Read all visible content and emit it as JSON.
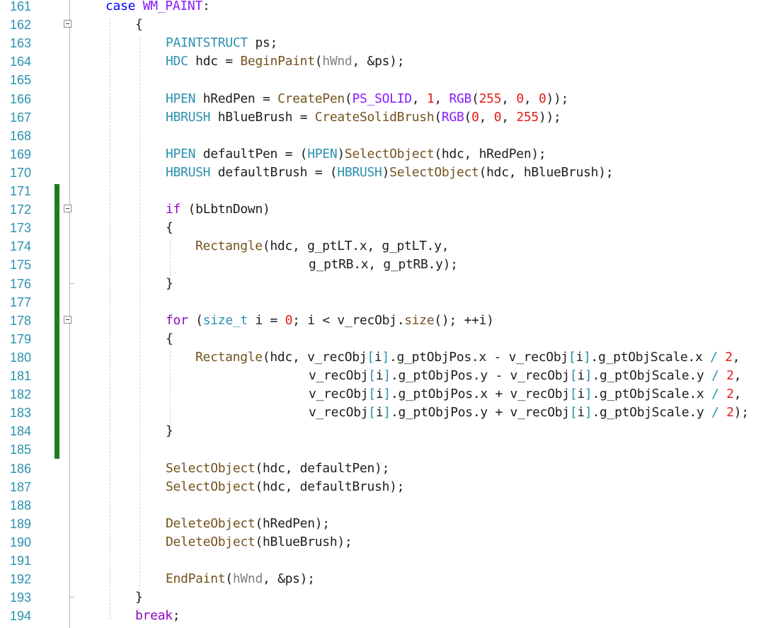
{
  "editor": {
    "line_numbers": [
      "161",
      "162",
      "163",
      "164",
      "165",
      "166",
      "167",
      "168",
      "169",
      "170",
      "171",
      "172",
      "173",
      "174",
      "175",
      "176",
      "177",
      "178",
      "179",
      "180",
      "181",
      "182",
      "183",
      "184",
      "185",
      "186",
      "187",
      "188",
      "189",
      "190",
      "191",
      "192",
      "193",
      "194"
    ],
    "colors": {
      "keyword": "#0000ff",
      "control_keyword": "#8f08c4",
      "type": "#2b91af",
      "function": "#74531f",
      "number": "#e51c1c",
      "parameter": "#808080",
      "line_number": "#2b91af",
      "change_bar": "#1f7a1f"
    },
    "lines": [
      {
        "ln": "161",
        "tokens": [
          {
            "t": "case ",
            "c": "kw"
          },
          {
            "t": "WM_PAINT",
            "c": "macro"
          },
          {
            "t": ":",
            "c": "plain"
          }
        ]
      },
      {
        "ln": "162",
        "tokens": [
          {
            "t": "{",
            "c": "plain"
          }
        ]
      },
      {
        "ln": "163",
        "tokens": [
          {
            "t": "PAINTSTRUCT",
            "c": "type"
          },
          {
            "t": " ps;",
            "c": "plain"
          }
        ]
      },
      {
        "ln": "164",
        "tokens": [
          {
            "t": "HDC",
            "c": "type"
          },
          {
            "t": " hdc = ",
            "c": "plain"
          },
          {
            "t": "BeginPaint",
            "c": "fn"
          },
          {
            "t": "(",
            "c": "plain"
          },
          {
            "t": "hWnd",
            "c": "param"
          },
          {
            "t": ", &ps);",
            "c": "plain"
          }
        ]
      },
      {
        "ln": "165",
        "tokens": []
      },
      {
        "ln": "166",
        "tokens": [
          {
            "t": "HPEN",
            "c": "type"
          },
          {
            "t": " hRedPen = ",
            "c": "plain"
          },
          {
            "t": "CreatePen",
            "c": "fn"
          },
          {
            "t": "(",
            "c": "plain"
          },
          {
            "t": "PS_SOLID",
            "c": "macro"
          },
          {
            "t": ", ",
            "c": "plain"
          },
          {
            "t": "1",
            "c": "num"
          },
          {
            "t": ", ",
            "c": "plain"
          },
          {
            "t": "RGB",
            "c": "macro"
          },
          {
            "t": "(",
            "c": "plain"
          },
          {
            "t": "255",
            "c": "num"
          },
          {
            "t": ", ",
            "c": "plain"
          },
          {
            "t": "0",
            "c": "num"
          },
          {
            "t": ", ",
            "c": "plain"
          },
          {
            "t": "0",
            "c": "num"
          },
          {
            "t": "));",
            "c": "plain"
          }
        ]
      },
      {
        "ln": "167",
        "tokens": [
          {
            "t": "HBRUSH",
            "c": "type"
          },
          {
            "t": " hBlueBrush = ",
            "c": "plain"
          },
          {
            "t": "CreateSolidBrush",
            "c": "fn"
          },
          {
            "t": "(",
            "c": "plain"
          },
          {
            "t": "RGB",
            "c": "macro"
          },
          {
            "t": "(",
            "c": "plain"
          },
          {
            "t": "0",
            "c": "num"
          },
          {
            "t": ", ",
            "c": "plain"
          },
          {
            "t": "0",
            "c": "num"
          },
          {
            "t": ", ",
            "c": "plain"
          },
          {
            "t": "255",
            "c": "num"
          },
          {
            "t": "));",
            "c": "plain"
          }
        ]
      },
      {
        "ln": "168",
        "tokens": []
      },
      {
        "ln": "169",
        "tokens": [
          {
            "t": "HPEN",
            "c": "type"
          },
          {
            "t": " defaultPen = (",
            "c": "plain"
          },
          {
            "t": "HPEN",
            "c": "type"
          },
          {
            "t": ")",
            "c": "plain"
          },
          {
            "t": "SelectObject",
            "c": "fn"
          },
          {
            "t": "(hdc, hRedPen);",
            "c": "plain"
          }
        ]
      },
      {
        "ln": "170",
        "tokens": [
          {
            "t": "HBRUSH",
            "c": "type"
          },
          {
            "t": " defaultBrush = (",
            "c": "plain"
          },
          {
            "t": "HBRUSH",
            "c": "type"
          },
          {
            "t": ")",
            "c": "plain"
          },
          {
            "t": "SelectObject",
            "c": "fn"
          },
          {
            "t": "(hdc, hBlueBrush);",
            "c": "plain"
          }
        ]
      },
      {
        "ln": "171",
        "tokens": []
      },
      {
        "ln": "172",
        "tokens": [
          {
            "t": "if",
            "c": "kw2"
          },
          {
            "t": " (bLbtnDown)",
            "c": "plain"
          }
        ]
      },
      {
        "ln": "173",
        "tokens": [
          {
            "t": "{",
            "c": "plain"
          }
        ]
      },
      {
        "ln": "174",
        "tokens": [
          {
            "t": "Rectangle",
            "c": "fn"
          },
          {
            "t": "(hdc, g_ptLT.x, g_ptLT.y,",
            "c": "plain"
          }
        ]
      },
      {
        "ln": "175",
        "tokens": [
          {
            "t": "g_ptRB.x, g_ptRB.y);",
            "c": "plain"
          }
        ]
      },
      {
        "ln": "176",
        "tokens": [
          {
            "t": "}",
            "c": "plain"
          }
        ]
      },
      {
        "ln": "177",
        "tokens": []
      },
      {
        "ln": "178",
        "tokens": [
          {
            "t": "for",
            "c": "kw2"
          },
          {
            "t": " (",
            "c": "plain"
          },
          {
            "t": "size_t",
            "c": "type"
          },
          {
            "t": " i = ",
            "c": "plain"
          },
          {
            "t": "0",
            "c": "num"
          },
          {
            "t": "; i < v_recObj.",
            "c": "plain"
          },
          {
            "t": "size",
            "c": "fn"
          },
          {
            "t": "(); ++i)",
            "c": "plain"
          }
        ]
      },
      {
        "ln": "179",
        "tokens": [
          {
            "t": "{",
            "c": "plain"
          }
        ]
      },
      {
        "ln": "180",
        "tokens": [
          {
            "t": "Rectangle",
            "c": "fn"
          },
          {
            "t": "(hdc, v_recObj",
            "c": "plain"
          },
          {
            "t": "[",
            "c": "idx"
          },
          {
            "t": "i",
            "c": "plain"
          },
          {
            "t": "]",
            "c": "idx"
          },
          {
            "t": ".g_ptObjPos.x - v_recObj",
            "c": "plain"
          },
          {
            "t": "[",
            "c": "idx"
          },
          {
            "t": "i",
            "c": "plain"
          },
          {
            "t": "]",
            "c": "idx"
          },
          {
            "t": ".g_ptObjScale.x ",
            "c": "plain"
          },
          {
            "t": "/",
            "c": "idx"
          },
          {
            "t": " ",
            "c": "plain"
          },
          {
            "t": "2",
            "c": "num"
          },
          {
            "t": ",",
            "c": "plain"
          }
        ]
      },
      {
        "ln": "181",
        "tokens": [
          {
            "t": "v_recObj",
            "c": "plain"
          },
          {
            "t": "[",
            "c": "idx"
          },
          {
            "t": "i",
            "c": "plain"
          },
          {
            "t": "]",
            "c": "idx"
          },
          {
            "t": ".g_ptObjPos.y - v_recObj",
            "c": "plain"
          },
          {
            "t": "[",
            "c": "idx"
          },
          {
            "t": "i",
            "c": "plain"
          },
          {
            "t": "]",
            "c": "idx"
          },
          {
            "t": ".g_ptObjScale.y ",
            "c": "plain"
          },
          {
            "t": "/",
            "c": "idx"
          },
          {
            "t": " ",
            "c": "plain"
          },
          {
            "t": "2",
            "c": "num"
          },
          {
            "t": ",",
            "c": "plain"
          }
        ]
      },
      {
        "ln": "182",
        "tokens": [
          {
            "t": "v_recObj",
            "c": "plain"
          },
          {
            "t": "[",
            "c": "idx"
          },
          {
            "t": "i",
            "c": "plain"
          },
          {
            "t": "]",
            "c": "idx"
          },
          {
            "t": ".g_ptObjPos.x + v_recObj",
            "c": "plain"
          },
          {
            "t": "[",
            "c": "idx"
          },
          {
            "t": "i",
            "c": "plain"
          },
          {
            "t": "]",
            "c": "idx"
          },
          {
            "t": ".g_ptObjScale.x ",
            "c": "plain"
          },
          {
            "t": "/",
            "c": "idx"
          },
          {
            "t": " ",
            "c": "plain"
          },
          {
            "t": "2",
            "c": "num"
          },
          {
            "t": ",",
            "c": "plain"
          }
        ]
      },
      {
        "ln": "183",
        "tokens": [
          {
            "t": "v_recObj",
            "c": "plain"
          },
          {
            "t": "[",
            "c": "idx"
          },
          {
            "t": "i",
            "c": "plain"
          },
          {
            "t": "]",
            "c": "idx"
          },
          {
            "t": ".g_ptObjPos.y + v_recObj",
            "c": "plain"
          },
          {
            "t": "[",
            "c": "idx"
          },
          {
            "t": "i",
            "c": "plain"
          },
          {
            "t": "]",
            "c": "idx"
          },
          {
            "t": ".g_ptObjScale.y ",
            "c": "plain"
          },
          {
            "t": "/",
            "c": "idx"
          },
          {
            "t": " ",
            "c": "plain"
          },
          {
            "t": "2",
            "c": "num"
          },
          {
            "t": ");",
            "c": "plain"
          }
        ]
      },
      {
        "ln": "184",
        "tokens": [
          {
            "t": "}",
            "c": "plain"
          }
        ]
      },
      {
        "ln": "185",
        "tokens": []
      },
      {
        "ln": "186",
        "tokens": [
          {
            "t": "SelectObject",
            "c": "fn"
          },
          {
            "t": "(hdc, defaultPen);",
            "c": "plain"
          }
        ]
      },
      {
        "ln": "187",
        "tokens": [
          {
            "t": "SelectObject",
            "c": "fn"
          },
          {
            "t": "(hdc, defaultBrush);",
            "c": "plain"
          }
        ]
      },
      {
        "ln": "188",
        "tokens": []
      },
      {
        "ln": "189",
        "tokens": [
          {
            "t": "DeleteObject",
            "c": "fn"
          },
          {
            "t": "(hRedPen);",
            "c": "plain"
          }
        ]
      },
      {
        "ln": "190",
        "tokens": [
          {
            "t": "DeleteObject",
            "c": "fn"
          },
          {
            "t": "(hBlueBrush);",
            "c": "plain"
          }
        ]
      },
      {
        "ln": "191",
        "tokens": []
      },
      {
        "ln": "192",
        "tokens": [
          {
            "t": "EndPaint",
            "c": "fn"
          },
          {
            "t": "(",
            "c": "plain"
          },
          {
            "t": "hWnd",
            "c": "param"
          },
          {
            "t": ", &ps);",
            "c": "plain"
          }
        ]
      },
      {
        "ln": "193",
        "tokens": [
          {
            "t": "}",
            "c": "plain"
          }
        ]
      },
      {
        "ln": "194",
        "tokens": [
          {
            "t": "break",
            "c": "kw2"
          },
          {
            "t": ";",
            "c": "plain"
          }
        ]
      }
    ]
  }
}
